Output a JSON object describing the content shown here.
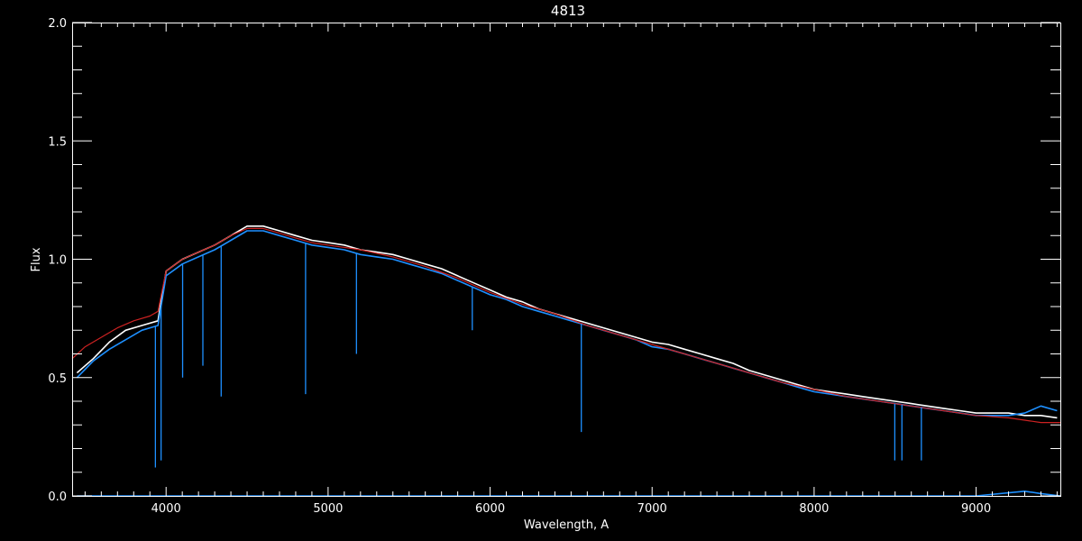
{
  "chart_data": {
    "type": "line",
    "title": "4813",
    "xlabel": "Wavelength, A",
    "ylabel": "Flux",
    "xlim": [
      3420,
      9520
    ],
    "ylim": [
      0.0,
      2.0
    ],
    "x_ticks": [
      4000,
      5000,
      6000,
      7000,
      8000,
      9000
    ],
    "y_ticks": [
      0.0,
      0.5,
      1.0,
      1.5,
      2.0
    ],
    "x_tick_labels": [
      "4000",
      "5000",
      "6000",
      "7000",
      "8000",
      "9000"
    ],
    "y_tick_labels": [
      "0.0",
      "0.5",
      "1.0",
      "1.5",
      "2.0"
    ],
    "grid": false,
    "background": "#000000",
    "axis_color": "#ffffff",
    "series": [
      {
        "color": "#ffffff",
        "x": [
          3450,
          3550,
          3650,
          3750,
          3850,
          3950,
          4000,
          4100,
          4200,
          4300,
          4400,
          4500,
          4600,
          4700,
          4800,
          4900,
          5000,
          5100,
          5200,
          5300,
          5400,
          5500,
          5600,
          5700,
          5800,
          5900,
          6000,
          6100,
          6200,
          6300,
          6400,
          6500,
          6600,
          6700,
          6800,
          6900,
          7000,
          7100,
          7200,
          7300,
          7400,
          7500,
          7600,
          7700,
          7800,
          7900,
          8000,
          8100,
          8200,
          8300,
          8400,
          8500,
          8600,
          8700,
          8800,
          8900,
          9000,
          9100,
          9200,
          9300,
          9400,
          9500
        ],
        "y": [
          0.52,
          0.58,
          0.65,
          0.7,
          0.72,
          0.74,
          0.95,
          1.0,
          1.03,
          1.06,
          1.1,
          1.14,
          1.14,
          1.12,
          1.1,
          1.08,
          1.07,
          1.06,
          1.04,
          1.03,
          1.02,
          1.0,
          0.98,
          0.96,
          0.93,
          0.9,
          0.87,
          0.84,
          0.82,
          0.79,
          0.77,
          0.75,
          0.73,
          0.71,
          0.69,
          0.67,
          0.65,
          0.64,
          0.62,
          0.6,
          0.58,
          0.56,
          0.53,
          0.51,
          0.49,
          0.47,
          0.45,
          0.44,
          0.43,
          0.42,
          0.41,
          0.4,
          0.39,
          0.38,
          0.37,
          0.36,
          0.35,
          0.35,
          0.35,
          0.34,
          0.34,
          0.33
        ]
      },
      {
        "color": "#1e90ff",
        "x": [
          3450,
          3550,
          3650,
          3750,
          3850,
          3950,
          4000,
          4100,
          4200,
          4300,
          4400,
          4500,
          4600,
          4700,
          4800,
          4900,
          5000,
          5100,
          5200,
          5300,
          5400,
          5500,
          5600,
          5700,
          5800,
          5900,
          6000,
          6100,
          6200,
          6300,
          6400,
          6500,
          6600,
          6700,
          6800,
          6900,
          7000,
          7100,
          7200,
          7300,
          7400,
          7500,
          7600,
          7700,
          7800,
          7900,
          8000,
          8100,
          8200,
          8300,
          8400,
          8500,
          8600,
          8700,
          8800,
          8900,
          9000,
          9100,
          9200,
          9300,
          9400,
          9500
        ],
        "y": [
          0.5,
          0.57,
          0.62,
          0.66,
          0.7,
          0.72,
          0.93,
          0.98,
          1.01,
          1.04,
          1.08,
          1.12,
          1.12,
          1.1,
          1.08,
          1.06,
          1.05,
          1.04,
          1.02,
          1.01,
          1.0,
          0.98,
          0.96,
          0.94,
          0.91,
          0.88,
          0.85,
          0.83,
          0.8,
          0.78,
          0.76,
          0.74,
          0.72,
          0.7,
          0.68,
          0.66,
          0.63,
          0.62,
          0.6,
          0.58,
          0.56,
          0.54,
          0.52,
          0.5,
          0.48,
          0.46,
          0.44,
          0.43,
          0.42,
          0.41,
          0.4,
          0.39,
          0.38,
          0.37,
          0.36,
          0.35,
          0.34,
          0.34,
          0.34,
          0.35,
          0.38,
          0.36
        ]
      },
      {
        "color": "#cc2222",
        "x": [
          3420,
          3500,
          3600,
          3700,
          3800,
          3900,
          3950,
          4000,
          4100,
          4200,
          4300,
          4400,
          4500,
          4600,
          4700,
          4800,
          4900,
          5000,
          5200,
          5400,
          5600,
          5800,
          6000,
          6200,
          6400,
          6600,
          6800,
          7000,
          7200,
          7400,
          7600,
          7800,
          8000,
          8200,
          8400,
          8600,
          8800,
          9000,
          9200,
          9300,
          9400,
          9520
        ],
        "y": [
          0.58,
          0.63,
          0.67,
          0.71,
          0.74,
          0.76,
          0.78,
          0.95,
          1.0,
          1.03,
          1.06,
          1.1,
          1.13,
          1.13,
          1.11,
          1.09,
          1.07,
          1.06,
          1.04,
          1.01,
          0.97,
          0.92,
          0.86,
          0.81,
          0.77,
          0.72,
          0.68,
          0.64,
          0.6,
          0.56,
          0.52,
          0.48,
          0.45,
          0.42,
          0.4,
          0.38,
          0.36,
          0.34,
          0.33,
          0.32,
          0.31,
          0.31
        ]
      },
      {
        "color": "#1e90ff",
        "x": [
          3450,
          4000,
          4500,
          5000,
          5500,
          6000,
          6500,
          7000,
          7500,
          8000,
          8500,
          9000,
          9300,
          9400,
          9520
        ],
        "y": [
          0.0,
          0.0,
          0.0,
          0.0,
          0.0,
          0.0,
          0.0,
          0.0,
          0.0,
          0.0,
          0.0,
          0.0,
          0.02,
          0.01,
          0.0
        ]
      }
    ],
    "absorption_lines": [
      {
        "x": 3934,
        "y": 0.12
      },
      {
        "x": 3969,
        "y": 0.15
      },
      {
        "x": 4102,
        "y": 0.5
      },
      {
        "x": 4227,
        "y": 0.55
      },
      {
        "x": 4340,
        "y": 0.42
      },
      {
        "x": 4861,
        "y": 0.43
      },
      {
        "x": 5175,
        "y": 0.6
      },
      {
        "x": 5890,
        "y": 0.7
      },
      {
        "x": 6563,
        "y": 0.27
      },
      {
        "x": 8498,
        "y": 0.15
      },
      {
        "x": 8542,
        "y": 0.15
      },
      {
        "x": 8662,
        "y": 0.15
      }
    ]
  }
}
